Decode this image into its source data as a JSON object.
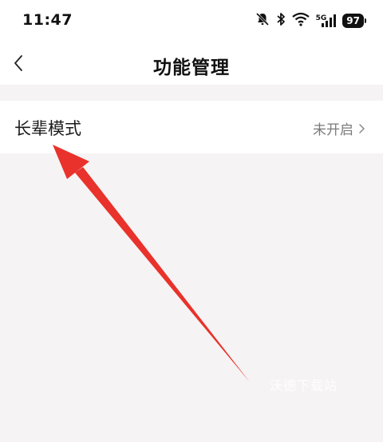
{
  "status_bar": {
    "time": "11:47",
    "network": "5G",
    "battery": "97",
    "icons": [
      "bell-muted-icon",
      "bluetooth-icon",
      "wifi-icon",
      "cellular-signal-icon",
      "battery-icon"
    ]
  },
  "header": {
    "back_icon": "back-chevron-icon",
    "title": "功能管理"
  },
  "settings": {
    "items": [
      {
        "label": "长辈模式",
        "value": "未开启",
        "icon": "chevron-right-icon"
      }
    ]
  },
  "annotation": {
    "arrow_color": "#e8322b"
  },
  "watermark": {
    "text": "沃德下载站"
  },
  "colors": {
    "background": "#f6f3f4",
    "surface": "#ffffff",
    "secondary_text": "#7a7a7a"
  }
}
